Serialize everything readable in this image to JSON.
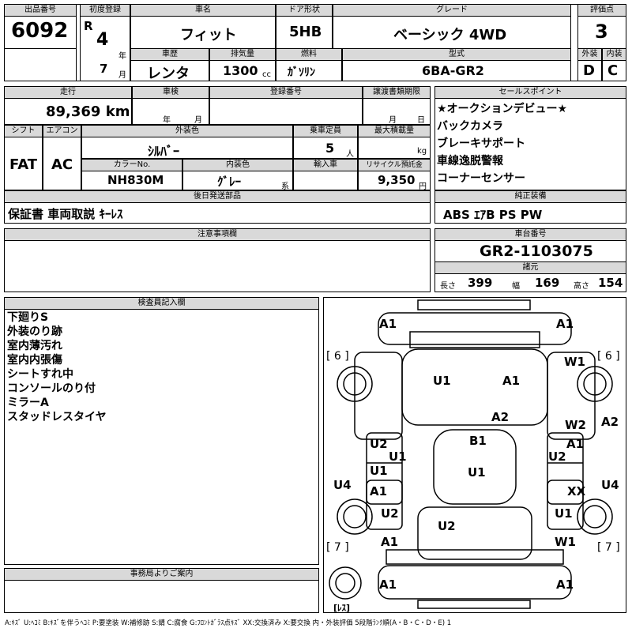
{
  "header": {
    "lot_no_label": "出品番号",
    "lot_no": "6092",
    "first_reg_label": "初度登録",
    "era": "R",
    "year": "4",
    "year_unit": "年",
    "month": "7",
    "month_unit": "月",
    "car_name_label": "車名",
    "car_name": "フィット",
    "door_label": "ドア形状",
    "door": "5HB",
    "grade_label": "グレード",
    "grade": "ベーシック 4WD",
    "score_label": "評価点",
    "score": "3",
    "history_label": "車歴",
    "history": "レンタ",
    "displacement_label": "排気量",
    "displacement": "1300",
    "displacement_unit": "cc",
    "fuel_label": "燃料",
    "fuel": "ｶﾞｿﾘﾝ",
    "model_label": "型式",
    "model": "6BA-GR2",
    "ext_label": "外装",
    "ext_score": "D",
    "int_label": "内装",
    "int_score": "C"
  },
  "row2": {
    "mileage_label": "走行",
    "mileage": "89,369 km",
    "inspection_label": "車検",
    "inspection_year": "年",
    "inspection_month": "月",
    "reg_no_label": "登録番号",
    "transfer_label": "譲渡書類期限",
    "transfer_month": "月",
    "transfer_day": "日",
    "shift_label": "シフト",
    "shift": "FAT",
    "ac_label": "エアコン",
    "ac": "AC",
    "color_label": "外装色",
    "color": "ｼﾙﾊﾞｰ",
    "capacity_label": "乗車定員",
    "capacity": "5",
    "capacity_unit": "人",
    "load_label": "最大積載量",
    "load_unit": "kg",
    "color_no_label": "カラーNo.",
    "color_no": "NH830M",
    "interior_label": "内装色",
    "interior": "ｸﾞﾚｰ",
    "interior_unit": "系",
    "import_label": "輸入車",
    "recycle_label": "リサイクル預託金",
    "recycle": "9,350",
    "recycle_unit": "円",
    "later_label": "後日発送部品",
    "later": "保証書 車両取説 ｷｰﾚｽ"
  },
  "sales": {
    "label": "セールスポイント",
    "items": [
      "★オークションデビュー★",
      "バックカメラ",
      "ブレーキサポート",
      "車線逸脱警報",
      "コーナーセンサー"
    ],
    "equip_label": "純正装備",
    "equip": "ABS ｴｱB PS PW",
    "chassis_label": "車台番号",
    "chassis": "GR2-1103075",
    "spec_label": "諸元",
    "length_label": "長さ",
    "length": "399",
    "width_label": "幅",
    "width": "169",
    "height_label": "高さ",
    "height": "154"
  },
  "caution_label": "注意事項欄",
  "inspector": {
    "label": "検査員記入欄",
    "notes": [
      "下廻りS",
      "外装のり跡",
      "室内薄汚れ",
      "室内内張傷",
      "シートすれ中",
      "コンソールのり付",
      "ミラーA",
      "スタッドレスタイヤ"
    ]
  },
  "office_label": "事務局よりご案内",
  "diagram": {
    "tire_left": "[ 6 ]",
    "tire_right": "[ 6 ]",
    "tire_rl": "[ 7 ]",
    "tire_rr": "[ 7 ]",
    "spare": "[ﾚｽ]",
    "codes": {
      "a1_fl": "A1",
      "a1_fr": "A1",
      "w1_fr": "W1",
      "u1_hood_l": "U1",
      "a1_hood_r": "A1",
      "a2_hood": "A2",
      "a2_right": "A2",
      "w2_rf": "W2",
      "a1_rf": "A1",
      "u2_lf": "U2",
      "u1_lf": "U1",
      "b1_roof": "B1",
      "u2_rf": "U2",
      "u1_ld": "U1",
      "u1_roof": "U1",
      "u4_left": "U4",
      "u4_right": "U4",
      "a1_ld": "A1",
      "xx_rd": "XX",
      "u2_lr": "U2",
      "u1_rr": "U1",
      "u2_rear": "U2",
      "a1_lr": "A1",
      "w1_rr": "W1",
      "a1_bl": "A1",
      "a1_br": "A1"
    }
  },
  "legend": "A:ｷｽﾞ U:ﾍｺﾐ B:ｷｽﾞを伴うﾍｺﾐ P:要塗装 W:補修跡 S:錆 C:腐食 G:ﾌﾛﾝﾄｶﾞﾗｽ点ｷｽﾞ XX:交換済み X:要交換 内・外装評価 5段階ﾗﾝｸ順(A・B・C・D・E) 1"
}
